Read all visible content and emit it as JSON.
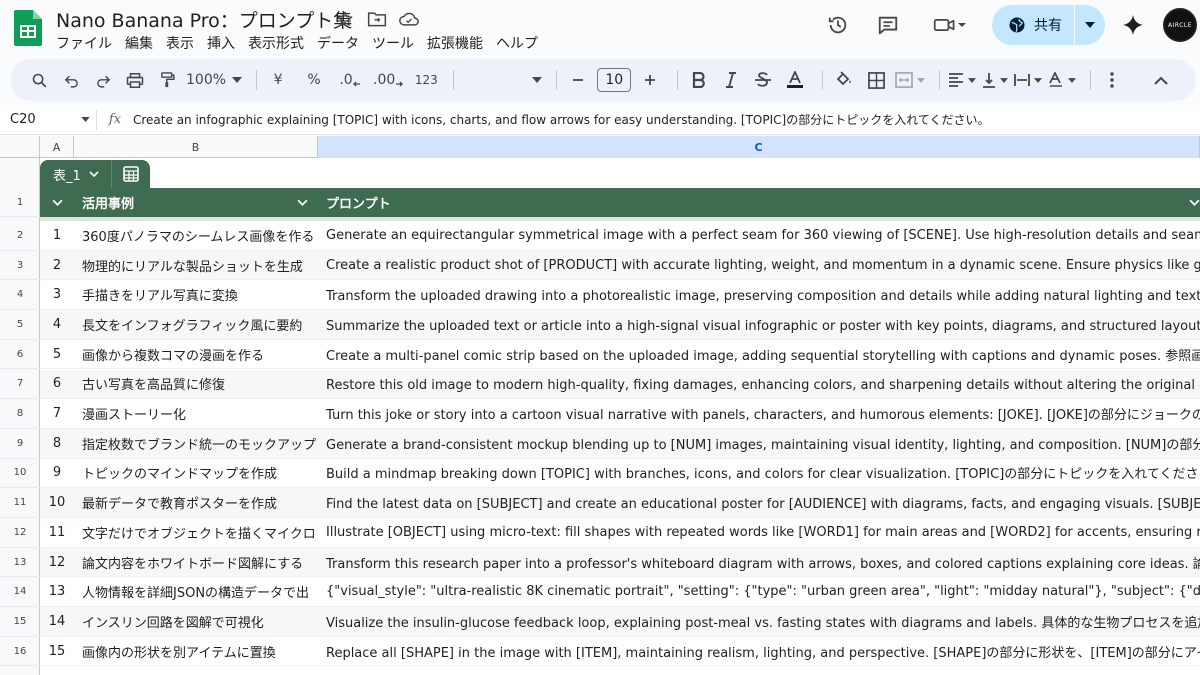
{
  "app": {
    "title": "Nano Banana Pro：プロンプト集",
    "share_label": "共有",
    "avatar_text": "AIRCLE"
  },
  "menu": [
    "ファイル",
    "編集",
    "表示",
    "挿入",
    "表示形式",
    "データ",
    "ツール",
    "拡張機能",
    "ヘルプ"
  ],
  "toolbar": {
    "zoom": "100%",
    "currency": "¥",
    "percent": "%",
    "dec_decrease": ".0",
    "dec_increase": ".00",
    "number_format": "123",
    "font_size": "10"
  },
  "formula_bar": {
    "cell_ref": "C20",
    "fx": "fx",
    "content": "Create an infographic explaining [TOPIC] with icons, charts, and flow arrows for easy understanding. [TOPIC]の部分にトピックを入れてください。"
  },
  "columns": {
    "a": "A",
    "b": "B",
    "c": "C"
  },
  "table": {
    "tab_name": "表_1",
    "header_b": "活用事例",
    "header_c": "プロンプト"
  },
  "row_numbers": [
    "1",
    "2",
    "3",
    "4",
    "5",
    "6",
    "7",
    "8",
    "9",
    "10",
    "11",
    "12",
    "13",
    "14",
    "15",
    "16"
  ],
  "rows": [
    {
      "num": "1",
      "case": "360度パノラマのシームレス画像を作る",
      "prompt": "Generate an equirectangular symmetrical image with a perfect seam for 360 viewing of [SCENE]. Use high-resolution details and seamless edges for"
    },
    {
      "num": "2",
      "case": "物理的にリアルな製品ショットを生成",
      "prompt": "Create a realistic product shot of [PRODUCT] with accurate lighting, weight, and momentum in a dynamic scene. Ensure physics like gravity and collis"
    },
    {
      "num": "3",
      "case": "手描きをリアル写真に変換",
      "prompt": "Transform the uploaded drawing into a photorealistic image, preserving composition and details while adding natural lighting and textures. 参照画像を"
    },
    {
      "num": "4",
      "case": "長文をインフォグラフィック風に要約",
      "prompt": "Summarize the uploaded text or article into a high-signal visual infographic or poster with key points, diagrams, and structured layout. テキストをアッ"
    },
    {
      "num": "5",
      "case": "画像から複数コマの漫画を作る",
      "prompt": "Create a multi-panel comic strip based on the uploaded image, adding sequential storytelling with captions and dynamic poses. 参照画像をアップロー"
    },
    {
      "num": "6",
      "case": "古い写真を高品質に修復",
      "prompt": "Restore this old image to modern high-quality, fixing damages, enhancing colors, and sharpening details without altering the original content. 古い写真"
    },
    {
      "num": "7",
      "case": "漫画ストーリー化",
      "prompt": "Turn this joke or story into a cartoon visual narrative with panels, characters, and humorous elements: [JOKE]. [JOKE]の部分にジョークのテキストを"
    },
    {
      "num": "8",
      "case": "指定枚数でブランド統一のモックアップ",
      "prompt": "Generate a brand-consistent mockup blending up to [NUM] images, maintaining visual identity, lighting, and composition. [NUM]の部分に画像数を入れ"
    },
    {
      "num": "9",
      "case": "トピックのマインドマップを作成",
      "prompt": "Build a mindmap breaking down [TOPIC] with branches, icons, and colors for clear visualization. [TOPIC]の部分にトピックを入れてください。"
    },
    {
      "num": "10",
      "case": "最新データで教育ポスターを作成",
      "prompt": "Find the latest data on [SUBJECT] and create an educational poster for [AUDIENCE] with diagrams, facts, and engaging visuals. [SUBJECT]の部分に"
    },
    {
      "num": "11",
      "case": "文字だけでオブジェクトを描くマイクロ",
      "prompt": "Illustrate [OBJECT] using micro-text: fill shapes with repeated words like [WORD1] for main areas and [WORD2] for accents, ensuring readability and"
    },
    {
      "num": "12",
      "case": "論文内容をホワイトボード図解にする",
      "prompt": "Transform this research paper into a professor's whiteboard diagram with arrows, boxes, and colored captions explaining core ideas. 論文テキストを"
    },
    {
      "num": "13",
      "case": "人物情報を詳細JSONの構造データで出",
      "prompt": "{\"visual_style\": \"ultra-realistic 8K cinematic portrait\", \"setting\": {\"type\": \"urban green area\", \"light\": \"midday natural\"}, \"subject\": {\"desc\": \"elegant woman"
    },
    {
      "num": "14",
      "case": "インスリン回路を図解で可視化",
      "prompt": "Visualize the insulin-glucose feedback loop, explaining post-meal vs. fasting states with diagrams and labels. 具体的な生物プロセスを追加してくださ"
    },
    {
      "num": "15",
      "case": "画像内の形状を別アイテムに置換",
      "prompt": "Replace all [SHAPE] in the image with [ITEM], maintaining realism, lighting, and perspective. [SHAPE]の部分に形状を、[ITEM]の部分にアイテムを入"
    }
  ]
}
